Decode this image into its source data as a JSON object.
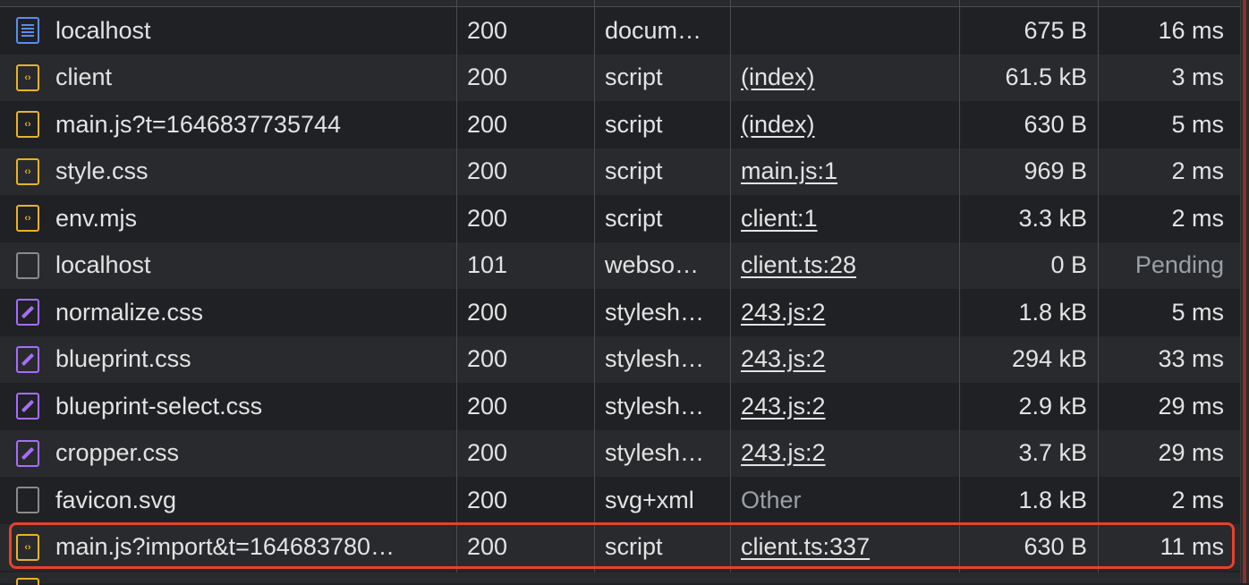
{
  "colors": {
    "script_icon": "#e8b325",
    "document_icon": "#5b8def",
    "stylesheet_icon": "#a66dff",
    "websocket_icon": "#8a8a8a",
    "highlight": "#e8412c"
  },
  "rows": [
    {
      "name": "localhost",
      "icon": "document-icon",
      "status": "200",
      "type": "docum…",
      "initiator": "",
      "initiator_link": false,
      "size": "675 B",
      "time": "16 ms"
    },
    {
      "name": "client",
      "icon": "script-icon",
      "status": "200",
      "type": "script",
      "initiator": "(index)",
      "initiator_link": true,
      "size": "61.5 kB",
      "time": "3 ms"
    },
    {
      "name": "main.js?t=1646837735744",
      "icon": "script-icon",
      "status": "200",
      "type": "script",
      "initiator": "(index)",
      "initiator_link": true,
      "size": "630 B",
      "time": "5 ms"
    },
    {
      "name": "style.css",
      "icon": "script-icon",
      "status": "200",
      "type": "script",
      "initiator": "main.js:1",
      "initiator_link": true,
      "size": "969 B",
      "time": "2 ms"
    },
    {
      "name": "env.mjs",
      "icon": "script-icon",
      "status": "200",
      "type": "script",
      "initiator": "client:1",
      "initiator_link": true,
      "size": "3.3 kB",
      "time": "2 ms"
    },
    {
      "name": "localhost",
      "icon": "websocket-icon",
      "status": "101",
      "type": "webso…",
      "initiator": "client.ts:28",
      "initiator_link": true,
      "size": "0 B",
      "time": "Pending"
    },
    {
      "name": "normalize.css",
      "icon": "stylesheet-icon",
      "status": "200",
      "type": "stylesh…",
      "initiator": "243.js:2",
      "initiator_link": true,
      "size": "1.8 kB",
      "time": "5 ms"
    },
    {
      "name": "blueprint.css",
      "icon": "stylesheet-icon",
      "status": "200",
      "type": "stylesh…",
      "initiator": "243.js:2",
      "initiator_link": true,
      "size": "294 kB",
      "time": "33 ms"
    },
    {
      "name": "blueprint-select.css",
      "icon": "stylesheet-icon",
      "status": "200",
      "type": "stylesh…",
      "initiator": "243.js:2",
      "initiator_link": true,
      "size": "2.9 kB",
      "time": "29 ms"
    },
    {
      "name": "cropper.css",
      "icon": "stylesheet-icon",
      "status": "200",
      "type": "stylesh…",
      "initiator": "243.js:2",
      "initiator_link": true,
      "size": "3.7 kB",
      "time": "29 ms"
    },
    {
      "name": "favicon.svg",
      "icon": "websocket-icon",
      "status": "200",
      "type": "svg+xml",
      "initiator": "Other",
      "initiator_link": false,
      "size": "1.8 kB",
      "time": "2 ms"
    },
    {
      "name": "main.js?import&t=164683780…",
      "icon": "script-icon",
      "status": "200",
      "type": "script",
      "initiator": "client.ts:337",
      "initiator_link": true,
      "size": "630 B",
      "time": "11 ms",
      "highlighted": true
    }
  ]
}
